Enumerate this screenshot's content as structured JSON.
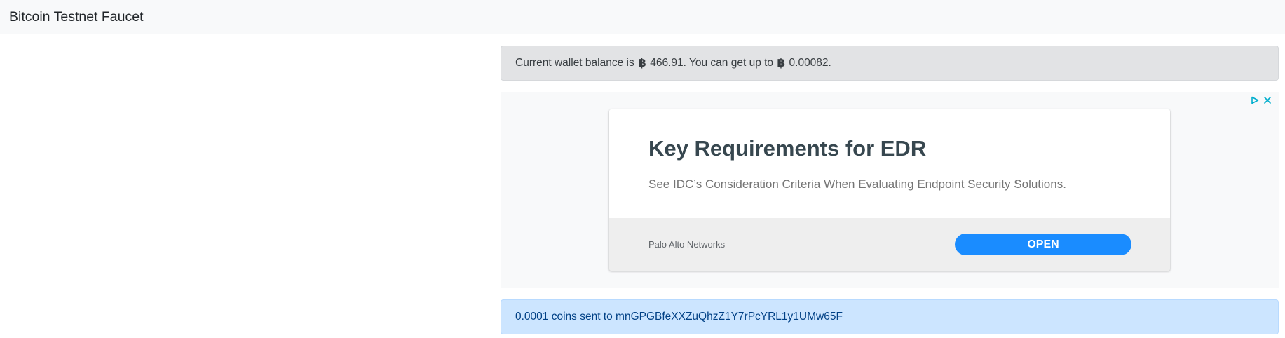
{
  "navbar": {
    "brand": "Bitcoin Testnet Faucet"
  },
  "balance_alert": {
    "prefix": "Current wallet balance is",
    "currency_symbol": "฿",
    "balance": "466.91",
    "middle": ". You can get up to",
    "max_amount": "0.00082",
    "suffix": "."
  },
  "ad": {
    "title": "Key Requirements for EDR",
    "description": "See IDC’s Consideration Criteria When Evaluating Endpoint Security Solutions.",
    "advertiser": "Palo Alto Networks",
    "cta": "OPEN",
    "cta_color": "#1a8cff",
    "adchoices_icon": "adchoices-icon",
    "close_icon": "close-icon"
  },
  "result_alert": {
    "message": "0.0001 coins sent to mnGPGBfeXXZuQhzZ1Y7rPcYRL1y1UMw65F"
  }
}
